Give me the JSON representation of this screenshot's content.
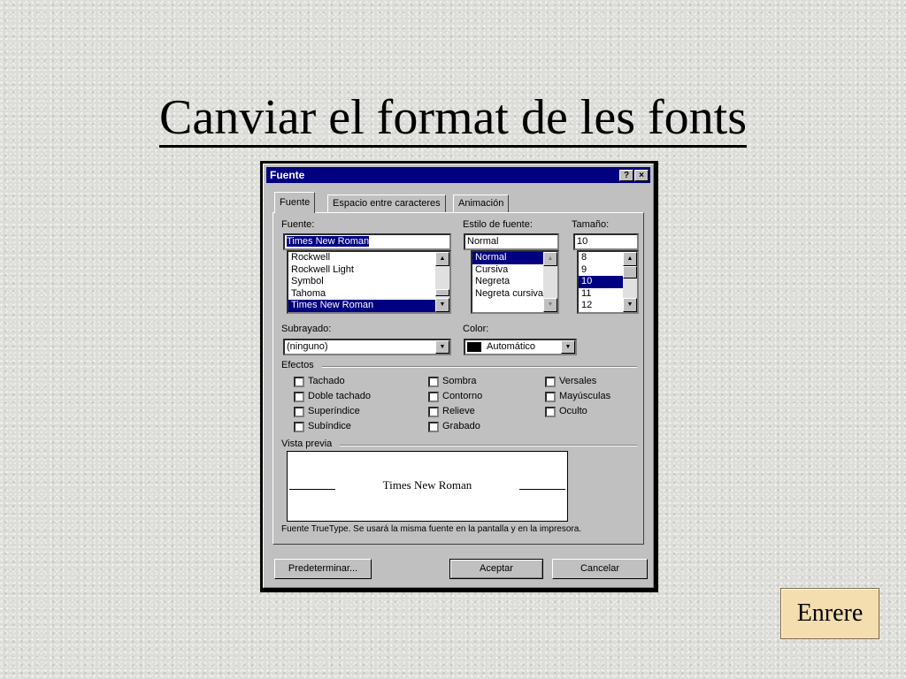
{
  "slide": {
    "title": "Canviar el format de les fonts",
    "back_button": "Enrere"
  },
  "dialog": {
    "title": "Fuente",
    "help_button": "?",
    "close_button": "×",
    "tabs": [
      {
        "label": "Fuente",
        "active": true
      },
      {
        "label": "Espacio entre caracteres",
        "active": false
      },
      {
        "label": "Animación",
        "active": false
      }
    ],
    "font": {
      "label": "Fuente:",
      "value": "Times New Roman",
      "options": [
        "Rockwell",
        "Rockwell Light",
        "Symbol",
        "Tahoma",
        "Times New Roman"
      ],
      "selected": "Times New Roman"
    },
    "style": {
      "label": "Estilo de fuente:",
      "value": "Normal",
      "options": [
        "Normal",
        "Cursiva",
        "Negreta",
        "Negreta cursiva"
      ],
      "selected": "Normal"
    },
    "size": {
      "label": "Tamaño:",
      "value": "10",
      "options": [
        "8",
        "9",
        "10",
        "11",
        "12"
      ],
      "selected": "10"
    },
    "underline": {
      "label": "Subrayado:",
      "value": "(ninguno)"
    },
    "color": {
      "label": "Color:",
      "value": "Automático",
      "swatch": "#000000"
    },
    "effects": {
      "label": "Efectos",
      "col1": [
        "Tachado",
        "Doble tachado",
        "Superíndice",
        "Subíndice"
      ],
      "col2": [
        "Sombra",
        "Contorno",
        "Relieve",
        "Grabado"
      ],
      "col3": [
        "Versales",
        "Mayúsculas",
        "Oculto"
      ]
    },
    "preview": {
      "label": "Vista previa",
      "sample": "Times New Roman",
      "note": "Fuente TrueType. Se usará la misma fuente en la pantalla y en la impresora."
    },
    "buttons": {
      "default": "Predeterminar...",
      "ok": "Aceptar",
      "cancel": "Cancelar"
    }
  },
  "colors": {
    "titlebar": "#000080",
    "dialog_face": "#c0c0c0",
    "selection": "#000080"
  }
}
